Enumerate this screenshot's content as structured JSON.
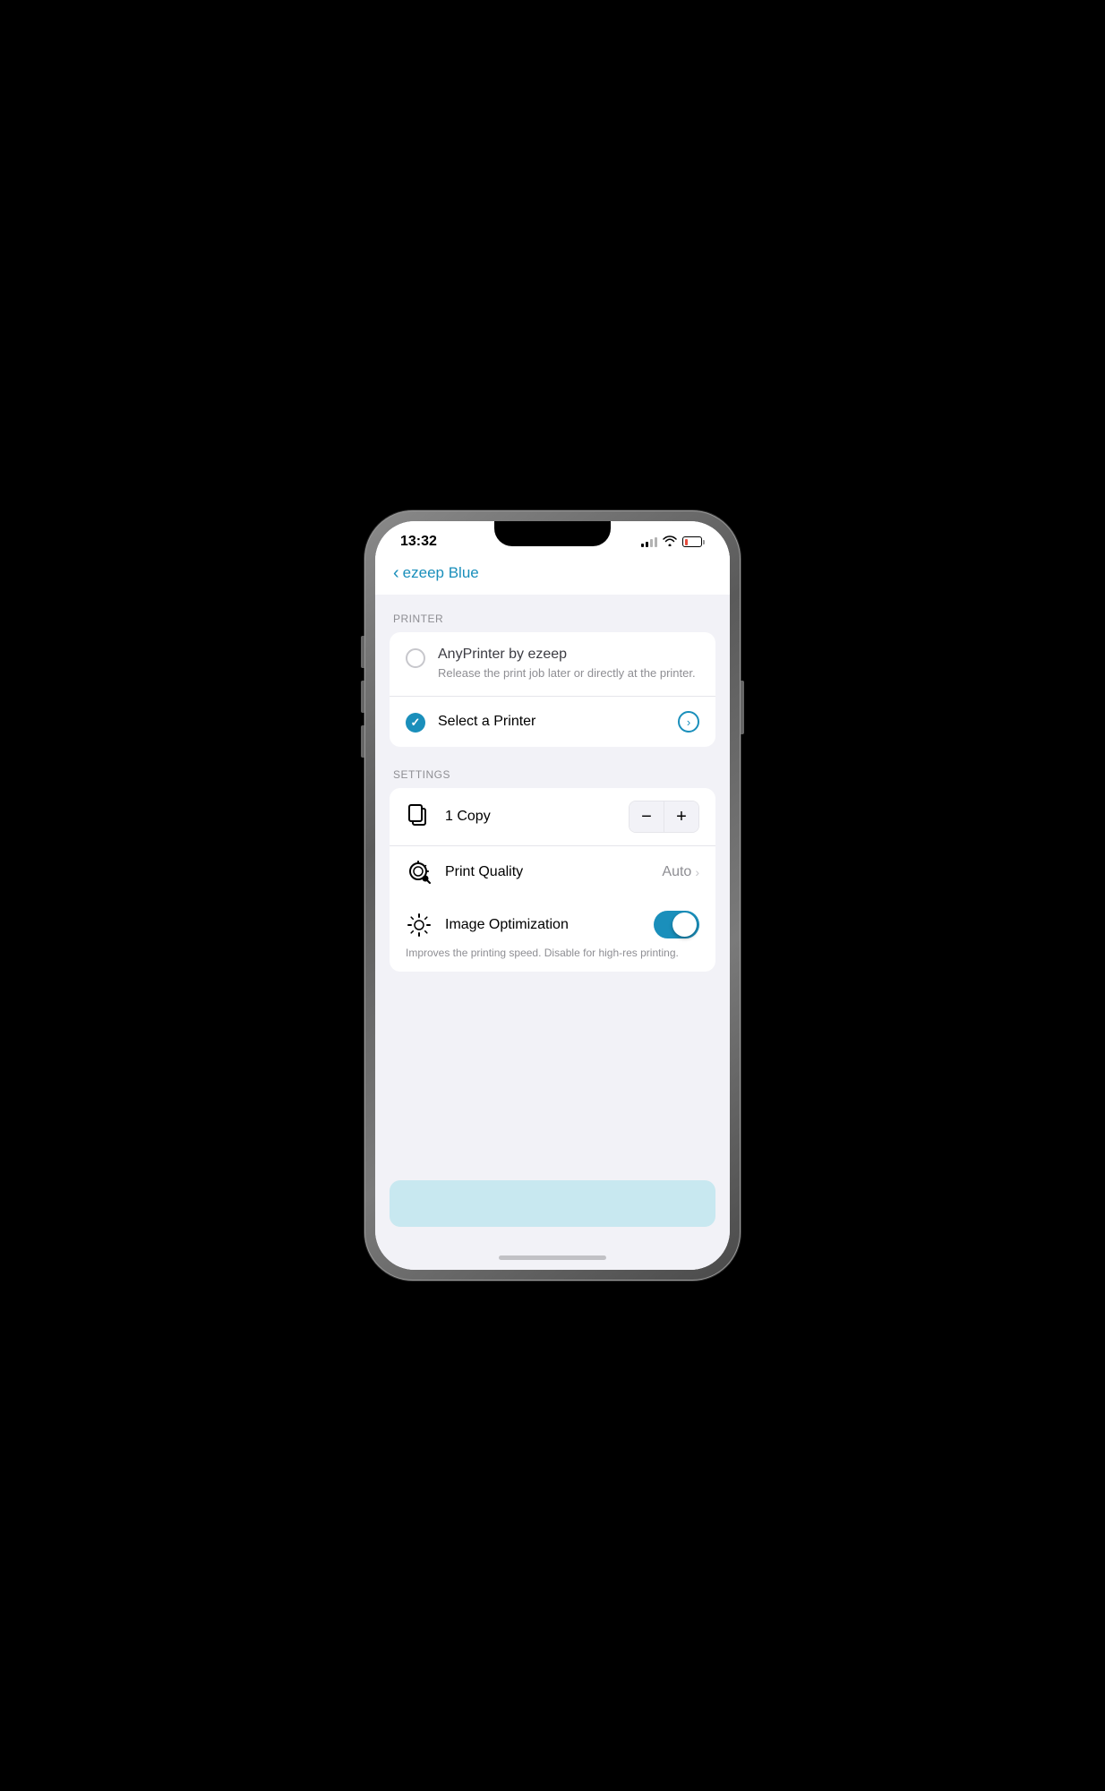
{
  "status_bar": {
    "time": "13:32"
  },
  "nav": {
    "back_label": "ezeep Blue"
  },
  "printer_section": {
    "label": "PRINTER",
    "anyprinter_name": "AnyPrinter by ezeep",
    "anyprinter_desc": "Release the print job later or directly at the printer.",
    "select_printer_label": "Select a Printer"
  },
  "settings_section": {
    "label": "SETTINGS",
    "copy_label": "1 Copy",
    "copy_minus": "−",
    "copy_plus": "+",
    "quality_label": "Print Quality",
    "quality_value": "Auto",
    "optimization_label": "Image Optimization",
    "optimization_desc": "Improves the printing speed. Disable for high-res printing."
  }
}
